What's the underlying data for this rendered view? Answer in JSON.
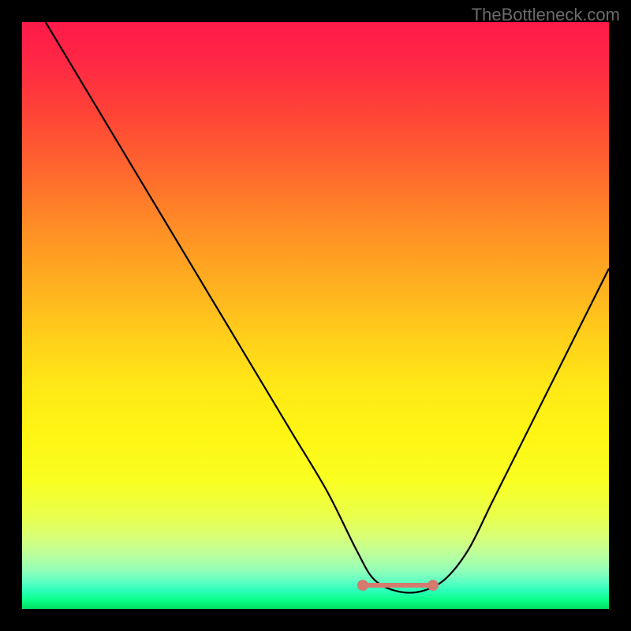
{
  "attribution": "TheBottleneck.com",
  "colors": {
    "background": "#000000",
    "curve_stroke": "#000000",
    "marker_fill": "#d47a6e"
  },
  "chart_data": {
    "type": "line",
    "title": "",
    "xlabel": "",
    "ylabel": "",
    "xlim": [
      0,
      100
    ],
    "ylim": [
      0,
      100
    ],
    "legend": false,
    "grid": false,
    "annotations": [
      "salmon valley marker between x≈58 and x≈70 at y≈4"
    ],
    "series": [
      {
        "name": "bottleneck-curve",
        "x": [
          4,
          10,
          16,
          22,
          28,
          34,
          40,
          46,
          52,
          57,
          60,
          64,
          68,
          72,
          76,
          80,
          84,
          88,
          92,
          96,
          100
        ],
        "y": [
          100,
          90,
          80,
          70,
          60,
          50,
          40,
          30,
          20,
          10,
          5,
          3,
          3,
          5,
          10,
          18,
          26,
          34,
          42,
          50,
          58
        ]
      }
    ],
    "valley_marker": {
      "x_start": 58,
      "x_end": 70,
      "y": 4
    }
  }
}
